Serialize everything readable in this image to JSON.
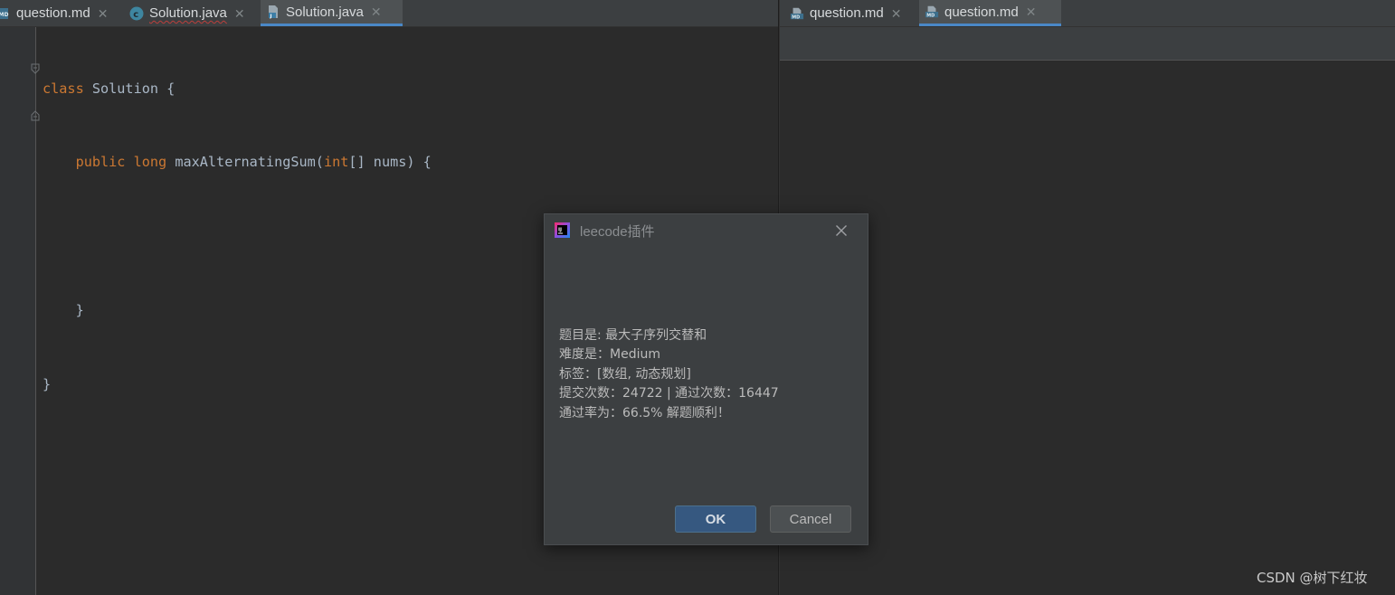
{
  "left_tabs": [
    {
      "label": "question.md",
      "icon": "markdown-file-icon",
      "active": false
    },
    {
      "label": "Solution.java",
      "icon": "java-class-icon",
      "active": false,
      "error_underline": true
    },
    {
      "label": "Solution.java",
      "icon": "java-file-icon",
      "active": true
    }
  ],
  "right_tabs": [
    {
      "label": "question.md",
      "icon": "markdown-file-icon",
      "active": false
    },
    {
      "label": "question.md",
      "icon": "markdown-file-icon",
      "active": true
    }
  ],
  "tab_close_glyph": "✕",
  "code": {
    "line1": {
      "kw": "class",
      "rest": " Solution {"
    },
    "line2": {
      "indent": "    ",
      "kw1": "public",
      "sp1": " ",
      "kw2": "long",
      "sp2": " ",
      "name": "maxAlternatingSum(",
      "kw3": "int",
      "rest": "[] nums) {"
    },
    "line3": "",
    "line4": "    }",
    "line5": "}"
  },
  "dialog": {
    "title": "leecode插件",
    "app_icon": "intellij-idea-icon",
    "lines": [
      "题目是: 最大子序列交替和",
      "难度是：Medium",
      "标签：[数组, 动态规划]",
      "提交次数：24722 | 通过次数：16447",
      "通过率为：66.5% 解题顺利！"
    ],
    "ok_label": "OK",
    "cancel_label": "Cancel"
  },
  "watermark": "CSDN @树下红妆",
  "colors": {
    "editor_bg": "#2b2b2b",
    "keyword": "#cc7832",
    "text": "#a9b7c6",
    "dialog_bg": "#3c3f41",
    "ok_button": "#365880"
  }
}
